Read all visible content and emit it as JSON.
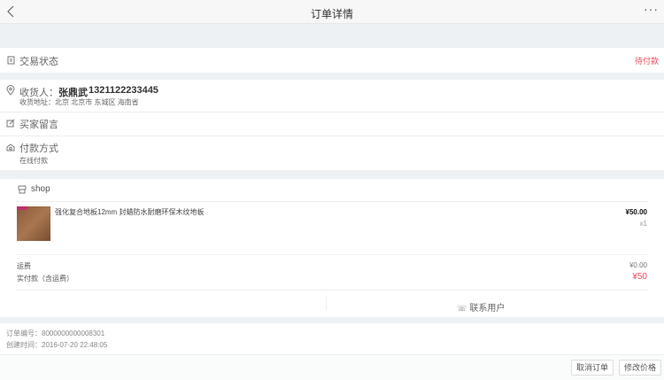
{
  "header": {
    "title": "订单详情",
    "back": "back-icon",
    "more": "more-icon"
  },
  "status": {
    "label": "交易状态",
    "value": "待付款",
    "color": "#f04d5f"
  },
  "address": {
    "label": "收货人：",
    "name": "张鼎武",
    "phone": "1321122233445",
    "detail": "收货地址：北京 北京市 东城区 海南省"
  },
  "message": {
    "label": "买家留言"
  },
  "payment": {
    "label": "付款方式",
    "value": "在线付款"
  },
  "shop": {
    "name": "shop"
  },
  "product": {
    "title": "强化复合地板12mm 封蜡防水耐磨环保木纹地板",
    "price": "¥50.00",
    "qty": "x1"
  },
  "fees": {
    "shipping_label": "运费",
    "shipping_value": "¥0.00",
    "total_label": "实付款（含运费）",
    "total_value": "¥50"
  },
  "contact": {
    "label": "联系用户"
  },
  "order": {
    "number": "订单编号：8000000000008301",
    "created": "创建时间：2016-07-20 22:48:05"
  },
  "footer": {
    "cancel": "取消订单",
    "modify": "修改价格"
  }
}
